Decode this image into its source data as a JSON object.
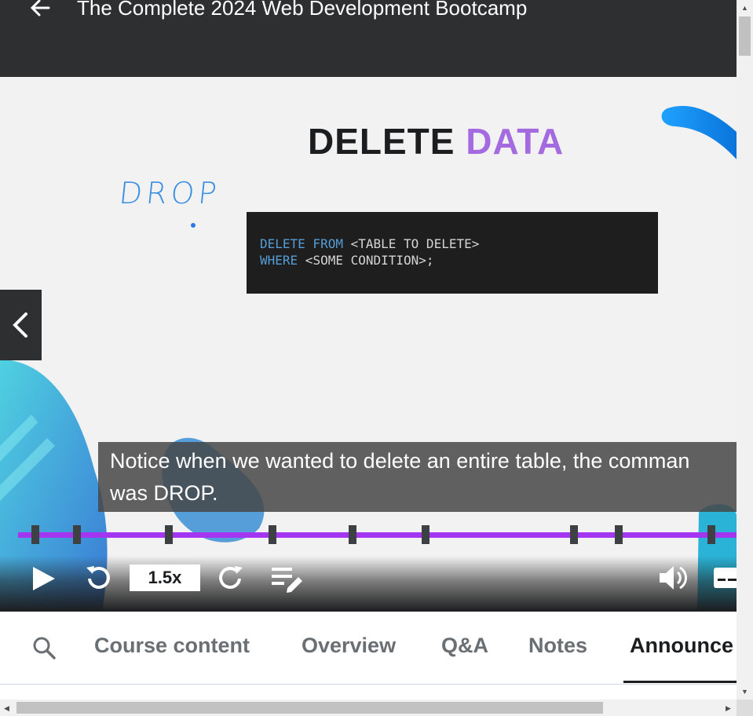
{
  "header": {
    "title": "The Complete 2024 Web Development Bootcamp"
  },
  "slide": {
    "title_main": "DELETE",
    "title_accent": "DATA",
    "handwritten_note": "DROP",
    "code_line1_kw": "DELETE FROM",
    "code_line1_rest": " <TABLE TO DELETE>",
    "code_line2_kw": "WHERE",
    "code_line2_rest": " <SOME CONDITION>;"
  },
  "player": {
    "subtitle_line1": "Notice when we wanted to delete an entire table, the comman",
    "subtitle_line2": "was DROP.",
    "speed": "1.5x",
    "progress_fraction": 0.97
  },
  "tabs": {
    "course_content": "Course content",
    "overview": "Overview",
    "qa": "Q&A",
    "notes": "Notes",
    "announcements": "Announce",
    "active": "announcements"
  },
  "colors": {
    "accent": "#a435f0",
    "header_bg": "#2d2f31",
    "slide_accent": "#a46be0",
    "code_keyword": "#569cd6"
  },
  "icons": [
    "back-arrow-icon",
    "chevron-left-icon",
    "play-icon",
    "rewind-icon",
    "forward-icon",
    "playlist-icon",
    "volume-icon",
    "captions-icon",
    "search-icon"
  ]
}
